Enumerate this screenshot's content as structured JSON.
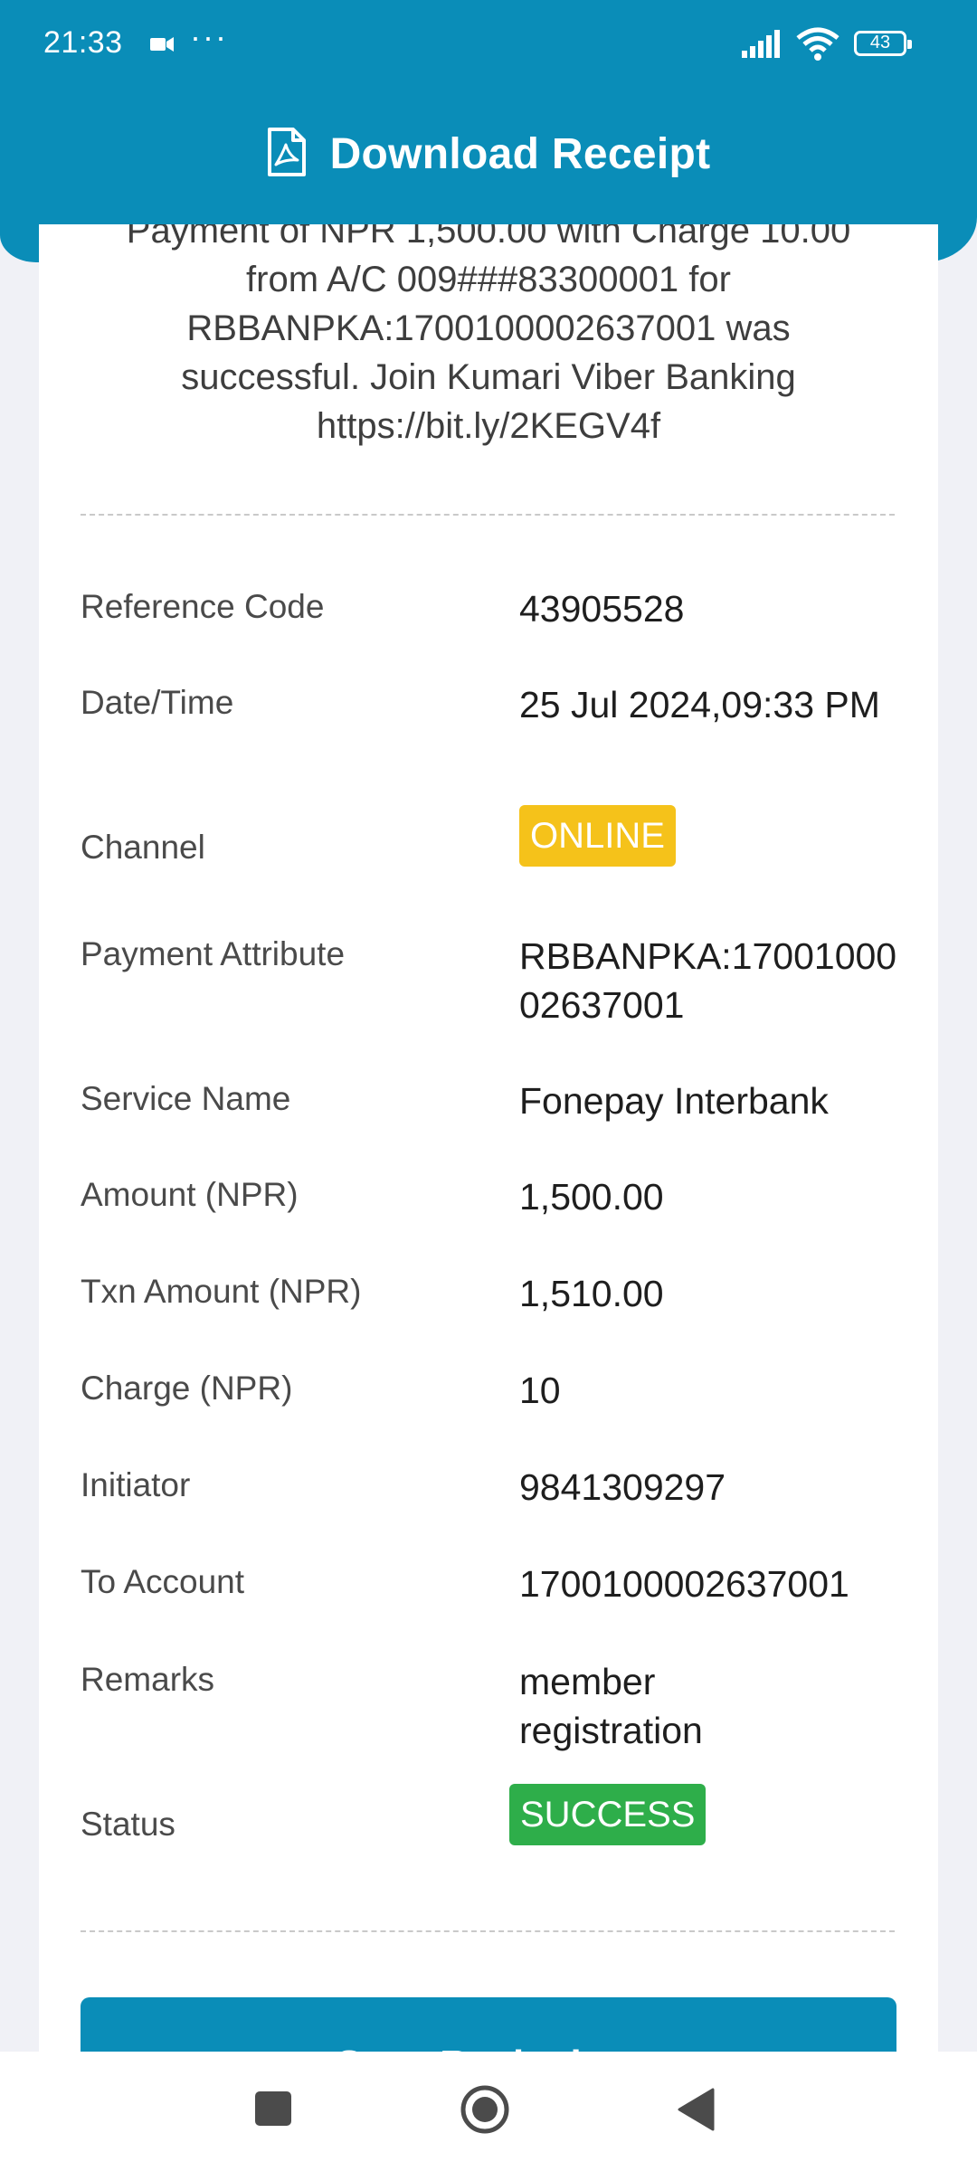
{
  "status_bar": {
    "time": "21:33",
    "dots": "···",
    "battery": "43"
  },
  "header": {
    "title": "Download Receipt"
  },
  "message": {
    "text": "Payment of NPR 1,500.00 with Charge 10.00 from A/C 009###83300001 for RBBANPKA:1700100002637001 was successful. Join Kumari Viber Banking https://bit.ly/2KEGV4f"
  },
  "details": {
    "reference_code": {
      "label": "Reference Code",
      "value": "43905528"
    },
    "date_time": {
      "label": "Date/Time",
      "value": "25 Jul 2024,09:33 PM"
    },
    "channel": {
      "label": "Channel",
      "value": "ONLINE"
    },
    "payment_attribute": {
      "label": "Payment Attribute",
      "value": "RBBANPKA:1700100002637001"
    },
    "service_name": {
      "label": "Service Name",
      "value": "Fonepay Interbank"
    },
    "amount": {
      "label": "Amount (NPR)",
      "value": "1,500.00"
    },
    "txn_amount": {
      "label": "Txn Amount (NPR)",
      "value": "1,510.00"
    },
    "charge": {
      "label": "Charge (NPR)",
      "value": "10"
    },
    "initiator": {
      "label": "Initiator",
      "value": "9841309297"
    },
    "to_account": {
      "label": "To Account",
      "value": "1700100002637001"
    },
    "remarks": {
      "label": "Remarks",
      "value": "member registration"
    },
    "status": {
      "label": "Status",
      "value": "SUCCESS"
    }
  },
  "actions": {
    "save_label": "Save Reciepient"
  },
  "colors": {
    "header": "#0a8db8",
    "online_badge": "#f5c21a",
    "success_badge": "#2eae4a",
    "background": "#f0f1f6"
  },
  "icons": {
    "header": "pdf-file-icon",
    "nav": [
      "recent-apps-icon",
      "home-icon",
      "back-icon"
    ]
  }
}
